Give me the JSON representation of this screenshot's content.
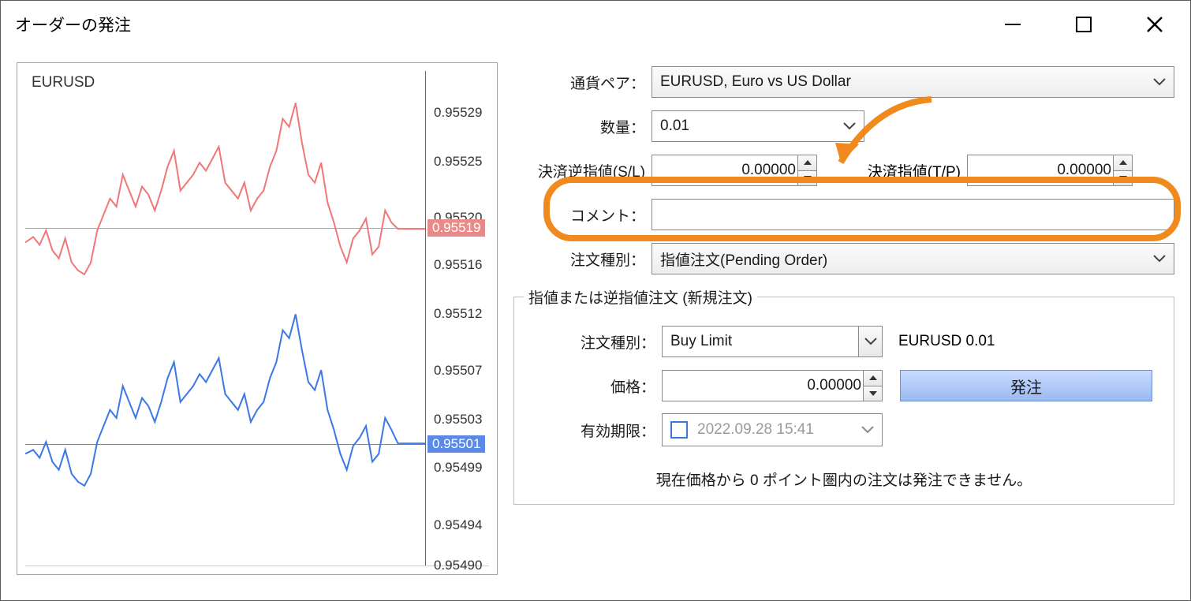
{
  "window": {
    "title": "オーダーの発注"
  },
  "chart": {
    "symbol": "EURUSD",
    "yticks": [
      "0.95529",
      "0.95525",
      "0.95520",
      "0.95516",
      "0.95512",
      "0.95507",
      "0.95503",
      "0.95499",
      "0.95494",
      "0.95490"
    ],
    "ask_price": "0.95519",
    "bid_price": "0.95501"
  },
  "form": {
    "pair_label": "通貨ペア：",
    "pair_value": "EURUSD, Euro vs US Dollar",
    "volume_label": "数量：",
    "volume_value": "0.01",
    "sl_label": "決済逆指値(S/L)",
    "sl_value": "0.00000",
    "tp_label": "決済指値(T/P)",
    "tp_value": "0.00000",
    "comment_label": "コメント：",
    "comment_value": "",
    "ordertype_label": "注文種別：",
    "ordertype_value": "指値注文(Pending Order)"
  },
  "pending": {
    "legend": "指値または逆指値注文 (新規注文)",
    "type_label": "注文種別：",
    "type_value": "Buy Limit",
    "symbol_lot": "EURUSD 0.01",
    "price_label": "価格：",
    "price_value": "0.00000",
    "submit_label": "発注",
    "expiry_label": "有効期限：",
    "expiry_value": "2022.09.28 15:41",
    "note": "現在価格から 0 ポイント圏内の注文は発注できません。"
  }
}
